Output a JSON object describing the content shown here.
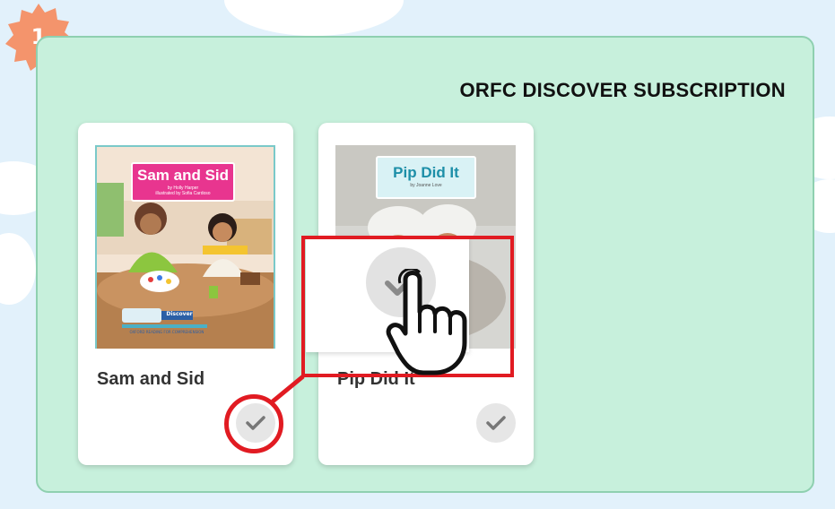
{
  "step": {
    "number": "1"
  },
  "panel": {
    "title": "ORFC DISCOVER SUBSCRIPTION"
  },
  "books": [
    {
      "title": "Sam and Sid",
      "cover_title": "Sam and Sid",
      "cover_author": "by Holly Harper",
      "cover_illustrator": "illustrated by Sofia Cardoso",
      "series_logo": "Discover",
      "series_tag": "OXFORD READING FOR COMPREHENSION",
      "selected": false
    },
    {
      "title": "Pip Did It",
      "cover_title": "Pip Did It",
      "cover_author": "by Joanne Love",
      "selected": false
    }
  ],
  "colors": {
    "background": "#e2f1fb",
    "panel": "#c7f0dc",
    "badge": "#f4946c",
    "highlight": "#e11b22",
    "check_button": "#e6e6e6"
  },
  "icons": {
    "check": "check-icon",
    "hand": "pointing-hand-icon",
    "badge": "starburst-badge"
  }
}
